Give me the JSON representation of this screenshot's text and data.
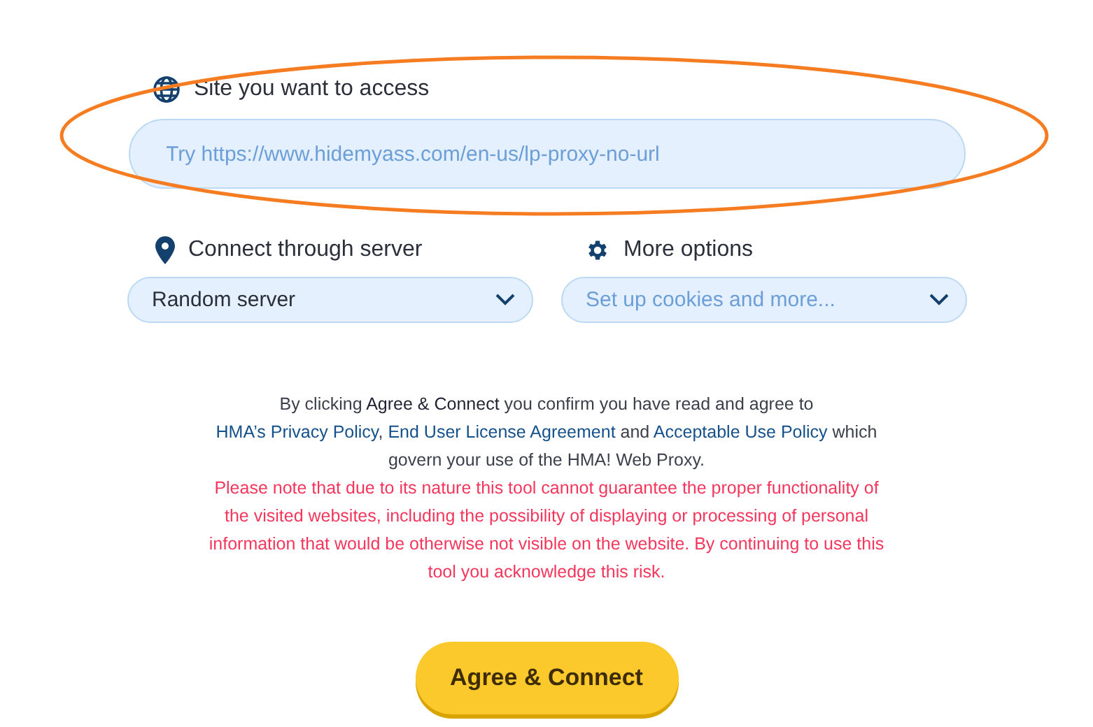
{
  "site_field": {
    "label": "Site you want to access",
    "placeholder": "Try https://www.hidemyass.com/en-us/lp-proxy-no-url"
  },
  "annotation": {
    "kind": "ellipse",
    "color": "#f57c20"
  },
  "server_select": {
    "label": "Connect through server",
    "value": "Random server"
  },
  "options_select": {
    "label": "More options",
    "placeholder": "Set up cookies and more..."
  },
  "consent": [
    {
      "kind": "text",
      "text": "By clicking "
    },
    {
      "kind": "bold",
      "text": "Agree & Connect"
    },
    {
      "kind": "text",
      "text": " you confirm you have read and agree to "
    },
    {
      "kind": "link",
      "text": "HMA’s Privacy Policy"
    },
    {
      "kind": "text",
      "text": ", "
    },
    {
      "kind": "link",
      "text": "End User License Agreement"
    },
    {
      "kind": "text",
      "text": " and "
    },
    {
      "kind": "link",
      "text": "Acceptable Use Policy"
    },
    {
      "kind": "text",
      "text": " which govern your use of the HMA! Web Proxy."
    }
  ],
  "warning": "Please note that due to its nature this tool cannot guarantee the proper functionality of the visited websites, including the possibility of displaying or processing of personal information that would be otherwise not visible on the website. By continuing to use this tool you acknowledge this risk.",
  "submit_button": "Agree & Connect"
}
